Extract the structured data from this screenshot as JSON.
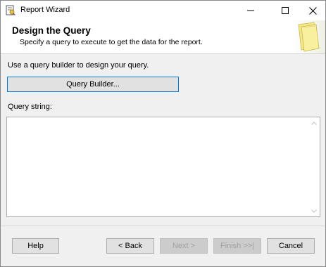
{
  "window": {
    "title": "Report Wizard"
  },
  "header": {
    "title": "Design the Query",
    "subtitle": "Specify a query to execute to get the data for the report."
  },
  "main": {
    "instruction": "Use a query builder to design your query.",
    "query_builder_label": "Query Builder...",
    "query_string_label": "Query string:",
    "query_string_value": ""
  },
  "footer": {
    "help_label": "Help",
    "back_label": "< Back",
    "next_label": "Next >",
    "finish_label": "Finish >>|",
    "cancel_label": "Cancel"
  },
  "colors": {
    "focus_border": "#0078d7",
    "disabled_text": "#a0a0a0"
  }
}
